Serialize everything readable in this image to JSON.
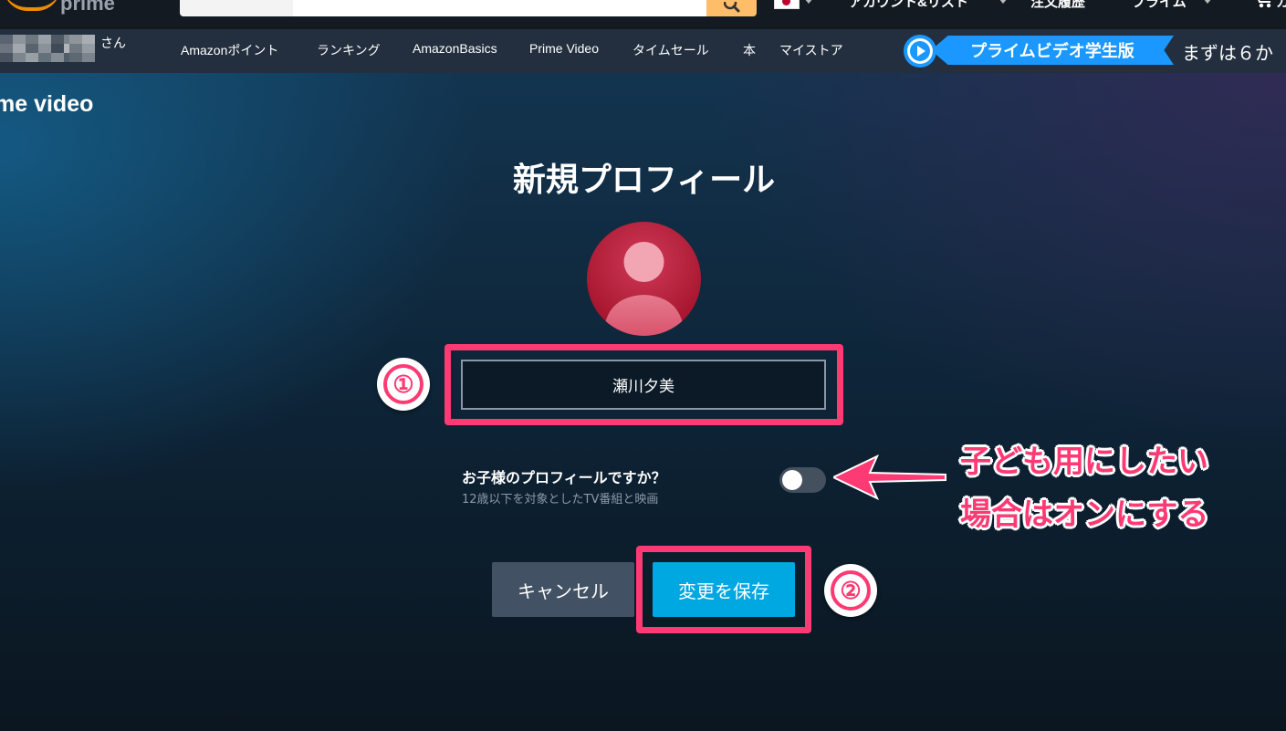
{
  "header": {
    "logo_text": "prime",
    "search_placeholder": "",
    "nav": {
      "account": "アカウント&リスト",
      "orders": "注文履歴",
      "prime": "プライム",
      "cart": "カ"
    }
  },
  "subnav": {
    "greeting_suffix": "さん",
    "items": [
      "Amazonポイント",
      "ランキング",
      "AmazonBasics",
      "Prime Video",
      "タイムセール",
      "本",
      "マイストア"
    ],
    "promo_banner": "プライムビデオ学生版",
    "promo_text": "まずは６か"
  },
  "main": {
    "brand": "me video",
    "title": "新規プロフィール",
    "name_value": "瀬川夕美",
    "kids_question": "お子様のプロフィールですか？",
    "kids_subtext": "12歳以下を対象としたTV番組と映画",
    "kids_toggle_on": false,
    "cancel_label": "キャンセル",
    "save_label": "変更を保存"
  },
  "annotations": {
    "step1": "①",
    "step2": "②",
    "note_line1": "子ども用にしたい",
    "note_line2": "場合はオンにする"
  },
  "colors": {
    "highlight": "#fd3a73",
    "save_button": "#00a8e1",
    "cancel_button": "#425163",
    "promo_blue": "#1a98ff"
  }
}
